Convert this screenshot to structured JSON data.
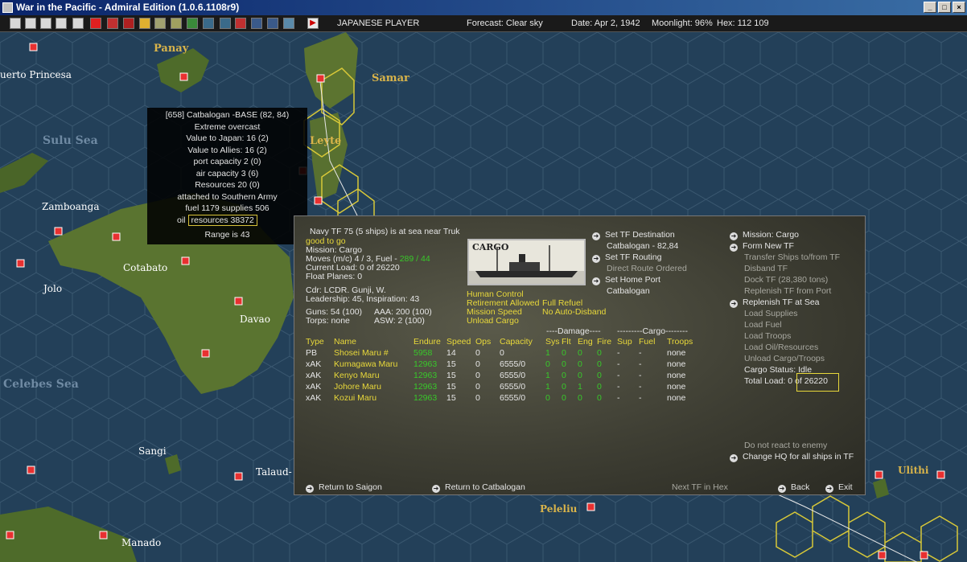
{
  "window": {
    "title": "War in the Pacific - Admiral Edition (1.0.6.1108r9)"
  },
  "status": {
    "player": "JAPANESE PLAYER",
    "forecast": "Forecast: Clear sky",
    "date": "Date: Apr 2, 1942",
    "moonlight": "Moonlight: 96%",
    "hex": "Hex: 112 109"
  },
  "map": {
    "land_labels": [
      "Panay",
      "Samar",
      "Leyte"
    ],
    "town_labels": [
      "uerto Princesa",
      "Zamboanga",
      "Cotabato",
      "Jolo",
      "Davao",
      "Sangi",
      "Talaud-",
      "Manado",
      "Peleliu",
      "Ulithi"
    ],
    "sea_labels": [
      "Sulu Sea",
      "Celebes Sea"
    ]
  },
  "base": {
    "header": "[658] Catbalogan -BASE (82, 84)",
    "weather": "Extreme overcast",
    "value_japan": "Value to Japan: 16 (2)",
    "value_allies": "Value to Allies: 16 (2)",
    "port": "port capacity 2 (0)",
    "air": "air capacity 3 (6)",
    "resources": "Resources  20 (0)",
    "attached": "attached to Southern Army",
    "fuel_supplies": "fuel 1179  supplies 506",
    "oil_label": "oil",
    "resources_box": "resources 38372",
    "range": "Range is 43"
  },
  "tf": {
    "heading": "Navy TF 75 (5 ships) is at sea near Truk",
    "good": "good to go",
    "mission": "Mission: Cargo",
    "moves_prefix": "Moves (m/c)  4 / 3, Fuel - ",
    "fuel_value": "289 / 44",
    "current_load": "Current Load:  0 of 26220",
    "float_planes": "Float Planes: 0",
    "cdr": "Cdr: LCDR. Gunji, W.",
    "leadership": "Leadership: 45, Inspiration: 43",
    "guns": "Guns: 54 (100)",
    "aaa": "AAA: 200 (100)",
    "torps": "Torps: none",
    "asw": "ASW: 2 (100)",
    "image_title": "CARGO",
    "human_control": "Human Control",
    "retirement": "Retirement Allowed",
    "full_refuel": "Full Refuel",
    "mission_speed": "Mission Speed",
    "no_auto": "No Auto-Disband",
    "unload_cargo": "Unload Cargo"
  },
  "dest": {
    "set_dest": "Set TF Destination",
    "dest_value": "Catbalogan - 82,84",
    "set_routing": "Set TF Routing",
    "direct_route": "Direct Route Ordered",
    "set_home": "Set Home Port",
    "home_value": "Catbalogan"
  },
  "menu": {
    "mission": "Mission: Cargo",
    "form_new": "Form New TF",
    "transfer": "Transfer Ships to/from TF",
    "disband": "Disband TF",
    "dock": "Dock TF (28,380 tons)",
    "replenish_port": "Replenish TF from Port",
    "replenish_sea": "Replenish TF at Sea",
    "load_supplies": "Load Supplies",
    "load_fuel": "Load Fuel",
    "load_troops": "Load Troops",
    "load_oil": "Load Oil/Resources",
    "unload": "Unload Cargo/Troops",
    "cargo_status": "Cargo Status: Idle",
    "total_load_prefix": "Total Load: 0 of ",
    "total_load_value": "26220",
    "no_react": "Do not react to enemy",
    "change_hq": "Change HQ for all ships in TF"
  },
  "table": {
    "group_damage": "----Damage----",
    "group_cargo": "---------Cargo--------",
    "headers": [
      "Type",
      "Name",
      "Endure",
      "Speed",
      "Ops",
      "Capacity",
      "Sys",
      "Flt",
      "Eng",
      "Fire",
      "Sup",
      "Fuel",
      "Troops"
    ],
    "rows": [
      [
        "PB",
        "Shosei Maru #",
        "5958",
        "14",
        "0",
        "0",
        "1",
        "0",
        "0",
        "0",
        "-",
        "-",
        "none"
      ],
      [
        "xAK",
        "Kumagawa Maru",
        "12963",
        "15",
        "0",
        "6555/0",
        "0",
        "0",
        "0",
        "0",
        "-",
        "-",
        "none"
      ],
      [
        "xAK",
        "Kenyo Maru",
        "12963",
        "15",
        "0",
        "6555/0",
        "1",
        "0",
        "0",
        "0",
        "-",
        "-",
        "none"
      ],
      [
        "xAK",
        "Johore Maru",
        "12963",
        "15",
        "0",
        "6555/0",
        "1",
        "0",
        "1",
        "0",
        "-",
        "-",
        "none"
      ],
      [
        "xAK",
        "Kozui Maru",
        "12963",
        "15",
        "0",
        "6555/0",
        "0",
        "0",
        "0",
        "0",
        "-",
        "-",
        "none"
      ]
    ]
  },
  "footer": {
    "return_saigon": "Return to Saigon",
    "return_catbalogan": "Return to Catbalogan",
    "next_tf": "Next TF in Hex",
    "back": "Back",
    "exit": "Exit"
  }
}
